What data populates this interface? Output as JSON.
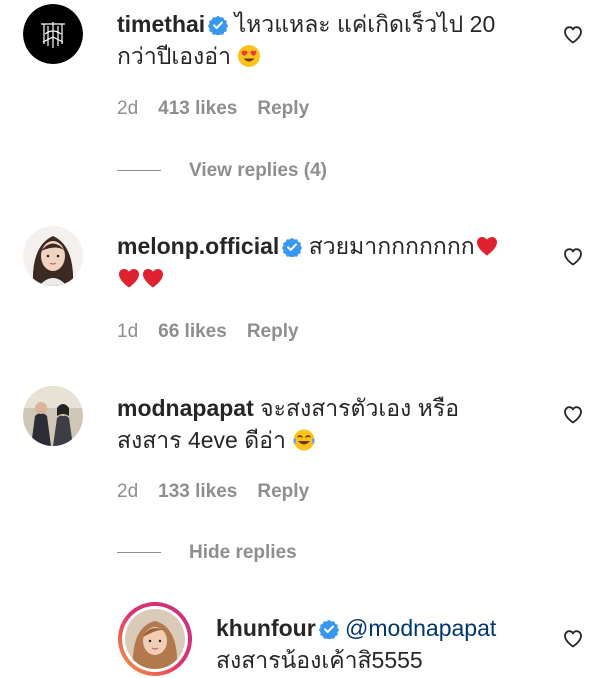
{
  "comments": [
    {
      "username": "timethai",
      "verified": true,
      "text_line1": "ไหวแหละ แค่เกิดเร็วไป 20",
      "text_line2": "กว่าปีเองอ่า",
      "time": "2d",
      "likes": "413 likes",
      "reply": "Reply",
      "replies_toggle": "View replies (4)"
    },
    {
      "username": "melonp.official",
      "verified": true,
      "text_line1": "สวยมากกกกกกก",
      "time": "1d",
      "likes": "66 likes",
      "reply": "Reply"
    },
    {
      "username": "modnapapat",
      "verified": false,
      "text_line1": "จะสงสารตัวเอง หรือ",
      "text_line2": "สงสาร 4eve ดีอ่า",
      "time": "2d",
      "likes": "133 likes",
      "reply": "Reply",
      "replies_toggle": "Hide replies"
    }
  ],
  "reply": {
    "username": "khunfour",
    "verified": true,
    "mention": "@modnapapat",
    "text_line2": "สงสารน้องเค้าสิ5555"
  },
  "colors": {
    "text": "#262626",
    "meta": "#8e8e8e",
    "verified": "#3897f0",
    "mention": "#00376b",
    "story_ring": "#e1306c"
  },
  "icons": [
    "verified-badge-icon",
    "heart-outline-icon",
    "red-heart-emoji",
    "heart-eyes-emoji",
    "tears-of-joy-emoji"
  ]
}
